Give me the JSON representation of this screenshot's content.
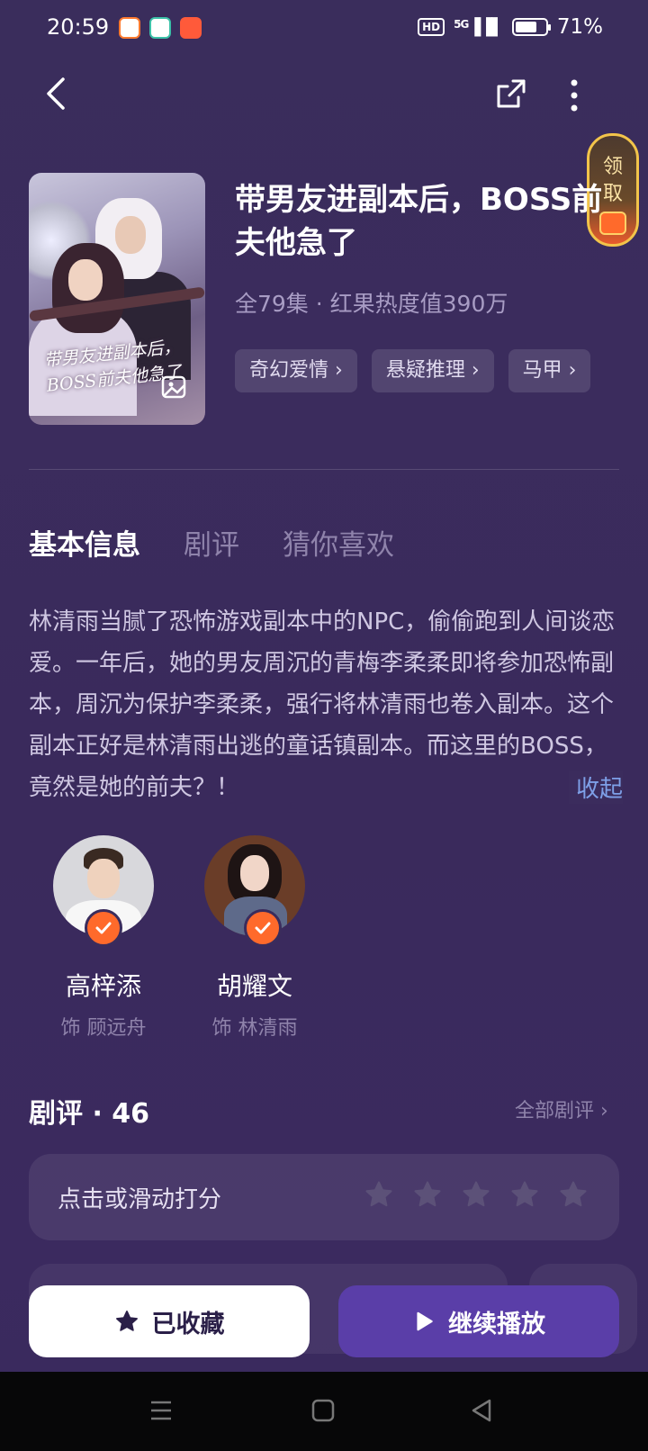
{
  "status_bar": {
    "time": "20:59",
    "network": "5G",
    "hd": "HD",
    "battery": "71%",
    "battery_level": 0.71,
    "app_icon_colors": [
      "#ff7a2f",
      "#3cc1a8",
      "#ff5a3a"
    ]
  },
  "header": {
    "back_icon": "chevron-left-icon",
    "share_icon": "share-icon",
    "more_icon": "more-vertical-icon",
    "reward_label_1": "领",
    "reward_label_2": "取"
  },
  "show": {
    "title": "带男友进副本后，BOSS前夫他急了",
    "poster_title": "带男友进副本后，BOSS前夫他急了",
    "meta": "全79集 · 红果热度值390万",
    "tags": [
      "奇幻爱情",
      "悬疑推理",
      "马甲"
    ]
  },
  "tabs": [
    "基本信息",
    "剧评",
    "猜你喜欢"
  ],
  "description": "林清雨当腻了恐怖游戏副本中的NPC，偷偷跑到人间谈恋爱。一年后，她的男友周沉的青梅李柔柔即将参加恐怖副本，周沉为保护李柔柔，强行将林清雨也卷入副本。这个副本正好是林清雨出逃的童话镇副本。而这里的BOSS，竟然是她的前夫？！",
  "collapse_label": "收起",
  "cast": [
    {
      "name": "高梓添",
      "role": "饰 顾远舟"
    },
    {
      "name": "胡耀文",
      "role": "饰 林清雨"
    }
  ],
  "reviews": {
    "title": "剧评 · 46",
    "all_link": "全部剧评 ›",
    "rate_prompt": "点击或滑动打分",
    "star_count": 5
  },
  "actions": {
    "favorite_label": "已收藏",
    "play_label": "继续播放"
  },
  "colors": {
    "accent_orange": "#ff6a2b",
    "play_button": "#5a3ea8",
    "link_blue": "#7ea0e8",
    "background": "#3a2c5c"
  }
}
